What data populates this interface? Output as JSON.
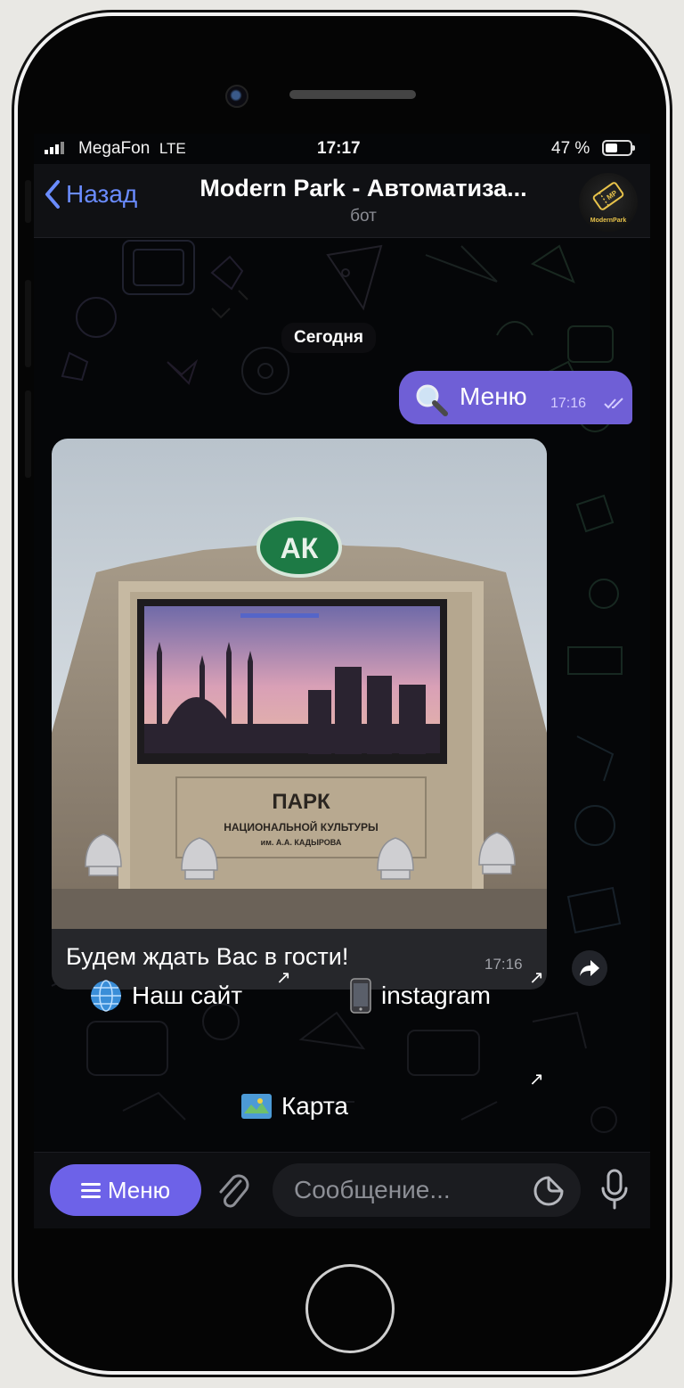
{
  "status_bar": {
    "carrier": "MegaFon",
    "network": "LTE",
    "time": "17:17",
    "battery": "47 %"
  },
  "nav": {
    "back_label": "Назад",
    "title": "Modern Park - Автоматиза...",
    "subtitle": "бот",
    "avatar_text": "ModernPark"
  },
  "chat": {
    "date_label": "Сегодня",
    "outgoing": {
      "icon": "magnifier-icon",
      "text": "Меню",
      "time": "17:16"
    },
    "photo_message": {
      "sign_lines": [
        "ПАРК",
        "НАЦИОНАЛЬНОЙ КУЛЬТУРЫ",
        "им. А.А. КАДЫРОВА"
      ],
      "logo_text": "АК",
      "caption": "Будем ждать Вас в гости!",
      "time": "17:16"
    },
    "inline_buttons": [
      {
        "icon": "globe-icon",
        "label": "Наш сайт"
      },
      {
        "icon": "phone-icon",
        "label": "instagram"
      },
      {
        "icon": "map-icon",
        "label": "Карта"
      }
    ]
  },
  "composer": {
    "menu_label": "Меню",
    "placeholder": "Сообщение..."
  },
  "colors": {
    "accent": "#6d62e8",
    "outgoing_bubble": "#6f5fd6",
    "link_blue": "#6a8cff",
    "background": "#050608"
  }
}
